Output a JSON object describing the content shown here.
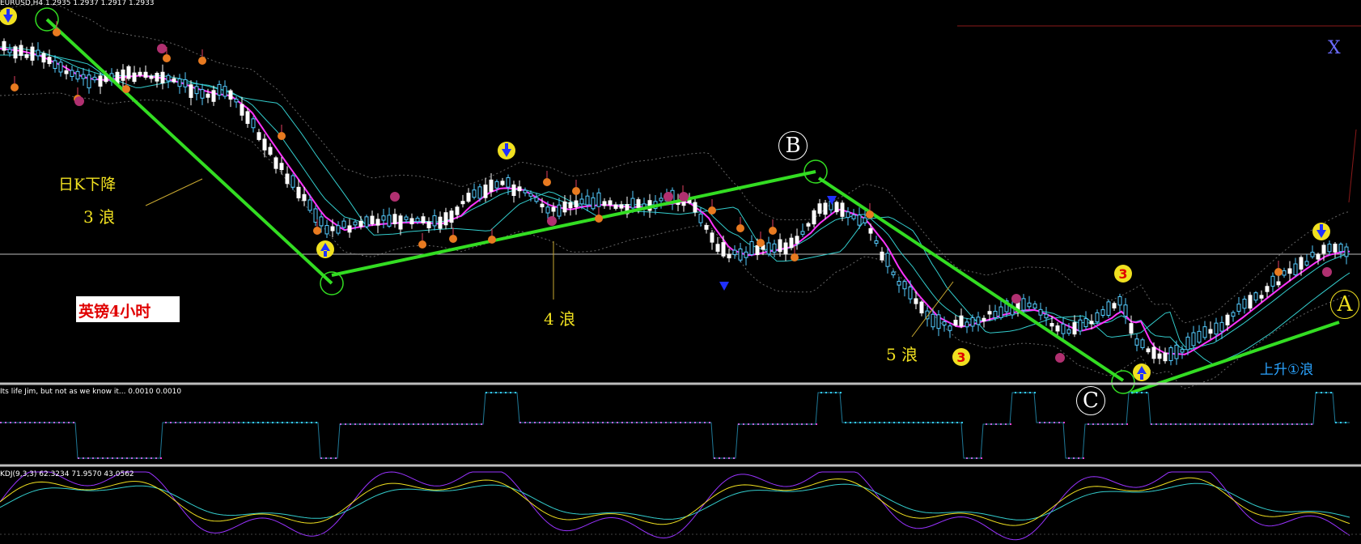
{
  "main_header": "EURUSD,H4 1.2935 1.2937 1.2917 1.2933",
  "indicator1_header": "Its life Jim, but not as we know it... 0.0010 0.0010",
  "indicator2_header": "KDJ(9,3,3) 62.3234 71.9570 43.0562",
  "labels": {
    "daily_k_down": "日K下降",
    "wave3": "3 浪",
    "gbp_4h": "英镑4小时",
    "wave4": "4 浪",
    "wave5": "5 浪",
    "rising_wave1": "上升①浪",
    "wave_a": "A",
    "wave_b": "B",
    "wave_c": "C",
    "x_mark": "X"
  },
  "colors": {
    "background": "#000000",
    "trendline": "#33dd22",
    "ma_fast": "#ff33ff",
    "ma_slow": "#33cccc",
    "label_yellow": "#f0e020",
    "label_cyan": "#2aa3ff",
    "candle_up": "#55ccff",
    "candle_down": "#ffffff",
    "osc_positive": "#33ccff",
    "osc_negative": "#ff33cc",
    "kdj_k": "#f0e020",
    "kdj_d": "#33cccc",
    "kdj_j": "#9933ff"
  },
  "chart_data": {
    "type": "line",
    "symbol": "EURUSD",
    "timeframe": "H4",
    "last_bar": {
      "open": 1.2935,
      "high": 1.2937,
      "low": 1.2917,
      "close": 1.2933
    },
    "series": [
      {
        "name": "Its life Jim, but not as we know it...",
        "last_values": [
          0.001,
          0.001
        ]
      },
      {
        "name": "KDJ(9,3,3)",
        "last_values": [
          62.3234,
          71.957,
          43.0562
        ]
      }
    ]
  }
}
